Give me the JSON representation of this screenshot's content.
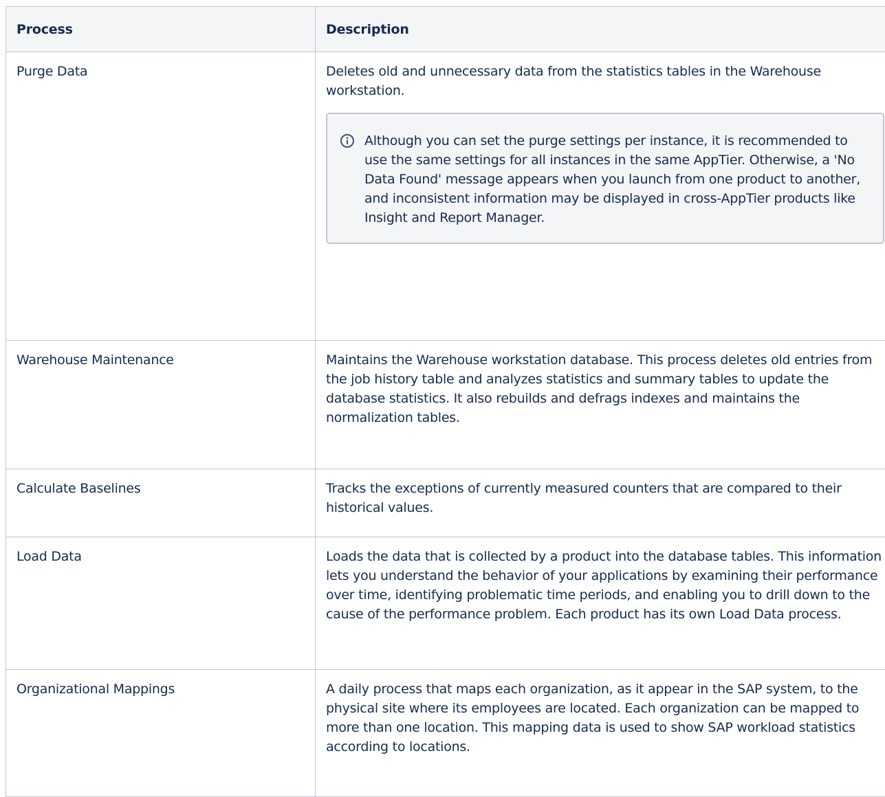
{
  "table": {
    "headers": {
      "process": "Process",
      "description": "Description"
    },
    "rows": [
      {
        "process": "Purge Data",
        "description": "Deletes old and unnecessary data from the statistics tables in the Warehouse workstation.",
        "note": {
          "icon": "info-icon",
          "text": "Although you can set the purge settings per instance, it is recommended to use the same settings for all instances in the same AppTier. Otherwise, a 'No Data Found' message appears when you launch from one product to another, and inconsistent information may be displayed in cross-AppTier products like Insight and Report Manager."
        }
      },
      {
        "process": "Warehouse Maintenance",
        "description": "Maintains the Warehouse workstation database. This process deletes old entries from the job history table and analyzes statistics and summary tables to update the database statistics. It also rebuilds and defrags indexes and maintains the normalization tables."
      },
      {
        "process": "Calculate Baselines",
        "description": "Tracks the exceptions of currently measured counters that are compared to their historical values."
      },
      {
        "process": "Load Data",
        "description": "Loads the data that is collected by a product into the database tables. This information lets you understand the behavior of your applications by examining their performance over time, identifying problematic time periods, and enabling you to drill down to the cause of the performance problem. Each product has its own Load Data process."
      },
      {
        "process": "Organizational Mappings",
        "description": "A daily process that maps each organization, as it appear in the SAP system, to the physical site where its employees are located. Each organization can be mapped to more than one location. This mapping data is used to show SAP workload statistics according to locations."
      }
    ]
  },
  "colors": {
    "border": "#c1c7d0",
    "header_bg": "#f4f5f7",
    "text": "#172b4d",
    "info_icon": "#42526e"
  }
}
